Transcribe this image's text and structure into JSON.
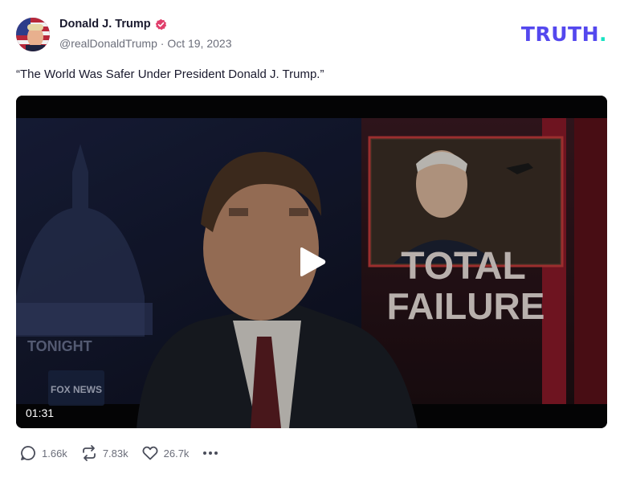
{
  "author": {
    "display_name": "Donald J. Trump",
    "handle": "@realDonaldTrump",
    "separator": "·",
    "date": "Oct 19, 2023",
    "verified_color": "#e03e6b"
  },
  "brand": {
    "logo_text": "TRUTH",
    "logo_dot": ".",
    "logo_color": "#5448ee",
    "dot_color": "#17e3c2"
  },
  "post": {
    "text": "“The World Was Safer Under President Donald J. Trump.”"
  },
  "video": {
    "duration": "01:31",
    "overlay_headline_1": "TOTAL",
    "overlay_headline_2": "FAILURE",
    "background_label": "TONIGHT",
    "channel_logo": "FOX NEWS"
  },
  "actions": {
    "replies": "1.66k",
    "reposts": "7.83k",
    "likes": "26.7k",
    "reply_icon": "reply-icon",
    "repost_icon": "repost-icon",
    "like_icon": "heart-icon",
    "more_icon": "more-icon"
  }
}
